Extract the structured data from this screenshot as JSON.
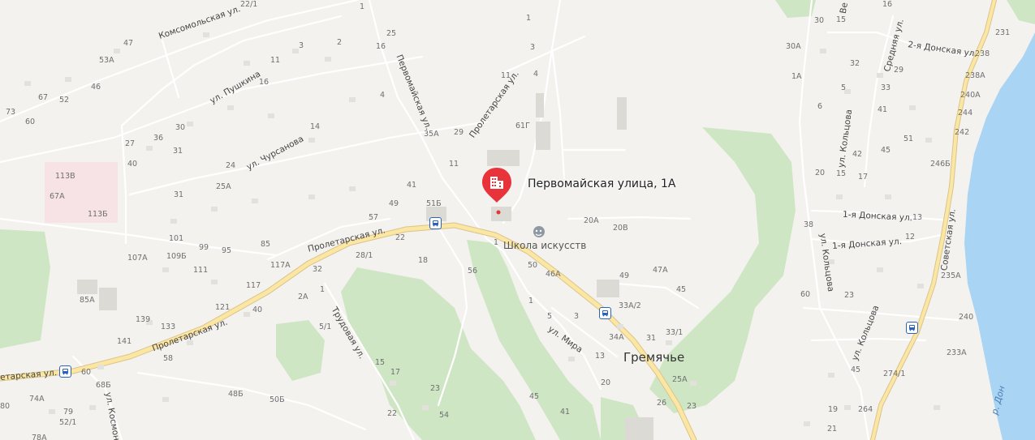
{
  "map": {
    "selected_place": {
      "label": "Первомайская улица, 1А",
      "icon": "building-icon",
      "color": "#e8333a"
    },
    "poi": {
      "label": "Школа искусств",
      "icon": "theater-icon"
    },
    "settlement": "Гремячье",
    "river": "р. Дон",
    "streets": {
      "komsomolskaya": "Комсомольская ул.",
      "pushkina": "ул. Пушкина",
      "chursanova": "ул. Чурсанова",
      "pervomayskaya": "Первомайская ул.",
      "proletarskaya_north": "Пролетарская ул.",
      "proletarskaya_main": "Пролетарская ул.",
      "proletarskaya_west": "Пролетарская ул.",
      "proletarskaya_edge": "етарская ул.",
      "trudovaya": "Трудовая ул.",
      "mira": "ул. Мира",
      "kosmo": "ул. Космон",
      "kolcova_top": "ул. Кольцова",
      "kolcova_mid": "ул. Кольцова",
      "kolcova_bottom": "ул. Кольцова",
      "donskaya1_a": "1-я Донская ул.",
      "donskaya1_b": "1-я Донская ул.",
      "donskaya2": "2-я Донская ул.",
      "srednyaya": "Средняя ул.",
      "sovetskaya": "Советская ул.",
      "edge_top_right": "Ве"
    },
    "house_numbers": {
      "n22_1": "22/1",
      "n1a": "1",
      "n25": "25",
      "n16a": "16",
      "n47": "47",
      "n53A": "53А",
      "n46": "46",
      "n3a": "3",
      "n2a": "2",
      "n11a": "11",
      "n16b": "16",
      "n67": "67",
      "n52": "52",
      "n73": "73",
      "n60": "60",
      "n30a": "30",
      "n36": "36",
      "n27": "27",
      "n31": "31",
      "n4a": "4",
      "n14": "14",
      "n24": "24",
      "n40a": "40",
      "n25A": "25А",
      "n113V": "113В",
      "n67A": "67А",
      "n113B": "113Б",
      "n57": "57",
      "n49": "49",
      "n41": "41",
      "n51B": "51Б",
      "n35A": "35А",
      "n29a": "29",
      "n11b": "11",
      "n1b": "1",
      "n3b": "3",
      "n11c": "11",
      "n4b": "4",
      "n61G": "61Г",
      "n20A": "20А",
      "n20V": "20В",
      "n101": "101",
      "n109B": "109Б",
      "n99": "99",
      "n95": "95",
      "n85": "85",
      "n107A": "107А",
      "n111": "111",
      "n22b": "22",
      "n28_1": "28/1",
      "n18": "18",
      "n117A": "117А",
      "n32": "32",
      "n56": "56",
      "n1c": "1",
      "n50": "50",
      "n46A": "46А",
      "n49b": "49",
      "n47A": "47А",
      "n45a": "45",
      "n33A_2": "33А/2",
      "n85A": "85А",
      "n117": "117",
      "n121": "121",
      "n40b": "40",
      "n2A": "2А",
      "n1d": "1",
      "n139": "139",
      "n133": "133",
      "n5_1": "5/1",
      "n141": "141",
      "n58": "58",
      "n1e": "1",
      "n5": "5",
      "n3c": "3",
      "n34A": "34А",
      "n31b": "31",
      "n33_1": "33/1",
      "n13a": "13",
      "n20b": "20",
      "n25Ab": "25А",
      "n26": "26",
      "n23a": "23",
      "n15a": "15",
      "n17a": "17",
      "n23b": "23",
      "n45b": "45",
      "n41b": "41",
      "n60b": "60",
      "n68B": "68Б",
      "n48B": "48Б",
      "n50B": "50Б",
      "n54": "54",
      "n22c": "22",
      "n74A": "74А",
      "n79": "79",
      "n52_1": "52/1",
      "n78A": "78А",
      "n80": "80",
      "n30b": "30",
      "n15b": "15",
      "n16c": "16",
      "n30A": "30А",
      "n1A": "1А",
      "n32b": "32",
      "n29b": "29",
      "n5b": "5",
      "n33": "33",
      "n6": "6",
      "n41c": "41",
      "n51": "51",
      "n42": "42",
      "n45c": "45",
      "n20c": "20",
      "n15c": "15",
      "n17b": "17",
      "n246B": "246Б",
      "n13b": "13",
      "n38": "38",
      "n12": "12",
      "n60c": "60",
      "n23c": "23",
      "n231": "231",
      "n238": "238",
      "n238A": "238А",
      "n240A": "240А",
      "n244": "244",
      "n242": "242",
      "n235A": "235А",
      "n240": "240",
      "n233A": "233А",
      "n45d": "45",
      "n274_1": "274/1",
      "n264": "264",
      "n19": "19",
      "n21": "21"
    },
    "bus_stop_icon": "bus-stop-icon"
  }
}
